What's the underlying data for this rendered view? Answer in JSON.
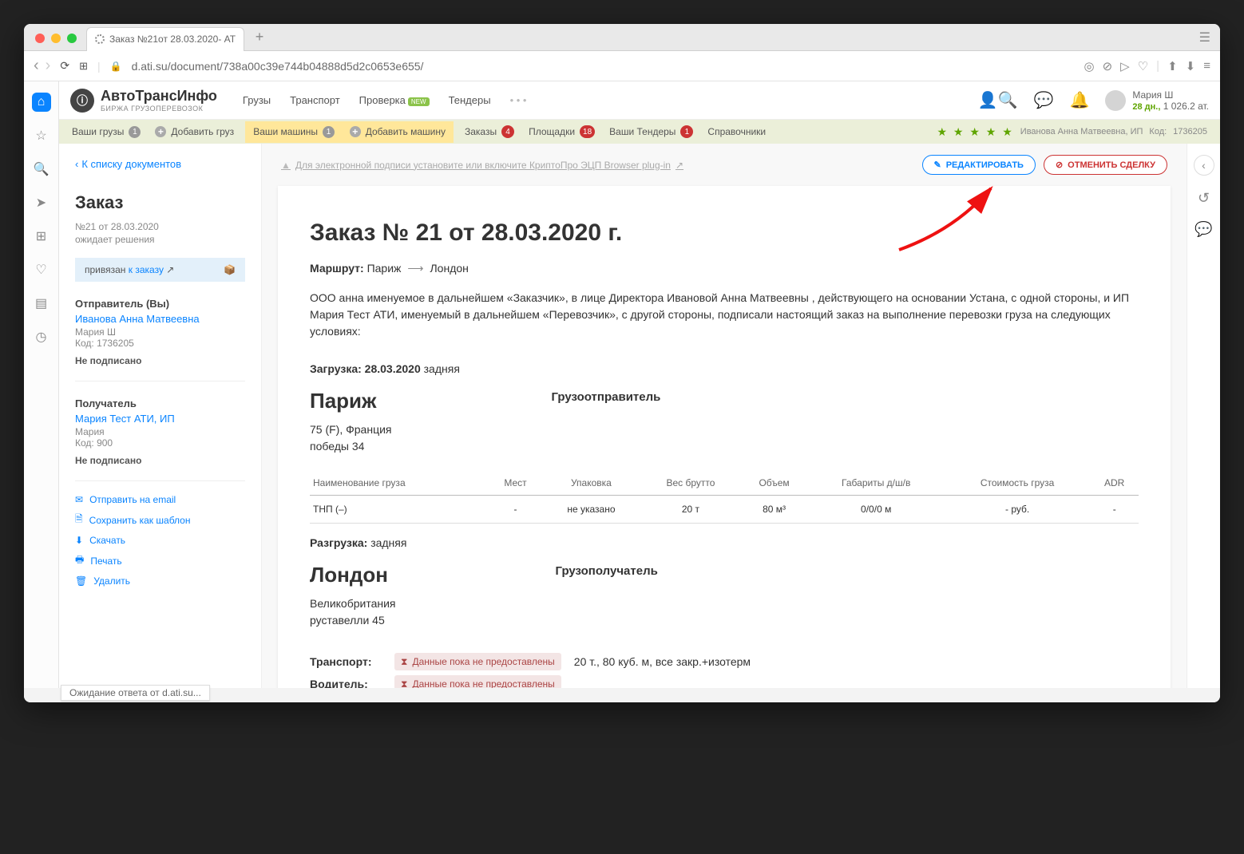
{
  "tab_title": "Заказ №21от 28.03.2020- АТ",
  "url": "d.ati.su/document/738a00c39e744b04888d5d2c0653e655/",
  "logo": {
    "name": "АвтоТрансИнфо",
    "sub": "БИРЖА ГРУЗОПЕРЕВОЗОК"
  },
  "top_nav": {
    "cargo": "Грузы",
    "transport": "Транспорт",
    "check": "Проверка",
    "new": "NEW",
    "tenders": "Тендеры"
  },
  "user": {
    "name": "Мария Ш",
    "days": "28 дн.,",
    "rating": "1 026.2 ат."
  },
  "ribbon": {
    "your_cargo": "Ваши грузы",
    "your_cargo_n": "1",
    "add_cargo": "Добавить груз",
    "your_trucks": "Ваши машины",
    "your_trucks_n": "1",
    "add_truck": "Добавить машину",
    "orders": "Заказы",
    "orders_n": "4",
    "platforms": "Площадки",
    "platforms_n": "18",
    "your_tenders": "Ваши Тендеры",
    "your_tenders_n": "1",
    "dirs": "Справочники",
    "owner": "Иванова Анна Матвеевна, ИП",
    "code_lbl": "Код:",
    "code": "1736205"
  },
  "left": {
    "back": "К списку документов",
    "title": "Заказ",
    "meta1": "№21 от 28.03.2020",
    "meta2": "ожидает решения",
    "bound_pre": "привязан",
    "bound_link": "к заказу",
    "sender_lbl": "Отправитель (Вы)",
    "sender_name": "Иванова Анна Матвеевна",
    "sender_person": "Мария Ш",
    "sender_code": "Код: 1736205",
    "unsigned": "Не подписано",
    "recip_lbl": "Получатель",
    "recip_name": "Мария Тест АТИ, ИП",
    "recip_person": "Мария",
    "recip_code": "Код: 900",
    "act_email": "Отправить на email",
    "act_tpl": "Сохранить как шаблон",
    "act_dl": "Скачать",
    "act_print": "Печать",
    "act_del": "Удалить"
  },
  "warn_text": "Для электронной подписи установите или включите КриптоПро ЭЦП Browser plug-in",
  "btn_edit": "РЕДАКТИРОВАТЬ",
  "btn_cancel": "ОТМЕНИТЬ СДЕЛКУ",
  "doc": {
    "h1": "Заказ №  21 от 28.03.2020 г.",
    "route_lbl": "Маршрут:",
    "route_from": "Париж",
    "route_to": "Лондон",
    "para": "ООО анна именуемое в дальнейшем «Заказчик», в лице Директора Ивановой Анна Матвеевны , действующего на основании Устана, с одной стороны, и ИП Мария Тест АТИ, именуемый в дальнейшем «Перевозчик», с другой стороны, подписали настоящий заказ на выполнение перевозки груза на следующих условиях:",
    "load_lbl": "Загрузка:",
    "load_date": "28.03.2020",
    "load_type": "задняя",
    "consignor": "Грузоотправитель",
    "city_from": "Париж",
    "country_from": "75 (F), Франция",
    "addr_from": "победы 34",
    "th": [
      "Наименование груза",
      "Мест",
      "Упаковка",
      "Вес брутто",
      "Объем",
      "Габариты д/ш/в",
      "Стоимость груза",
      "ADR"
    ],
    "row": [
      "ТНП (–)",
      "-",
      "не указано",
      "20 т",
      "80 м³",
      "0/0/0 м",
      "- руб.",
      "-"
    ],
    "unload_lbl": "Разгрузка:",
    "unload_type": "задняя",
    "consignee": "Грузополучатель",
    "city_to": "Лондон",
    "country_to": "Великобритания",
    "addr_to": "руставелли 45",
    "transport_lbl": "Транспорт:",
    "nodata": "Данные пока не предоставлены",
    "transport_specs": "20 т., 80 куб. м, все закр.+изотерм",
    "driver_lbl": "Водитель:"
  },
  "status": "Ожидание ответа от d.ati.su..."
}
